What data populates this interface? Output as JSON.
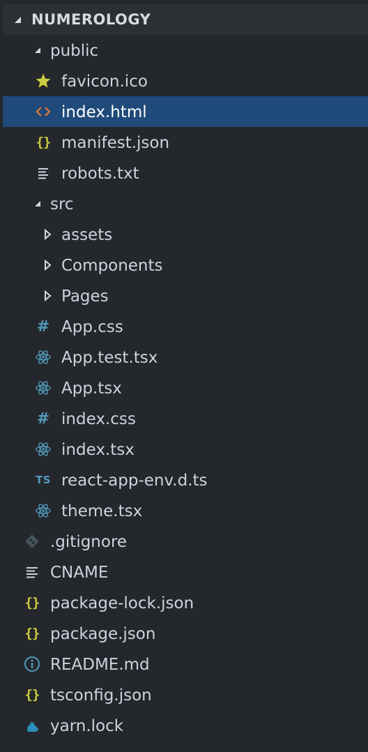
{
  "explorer": {
    "section_title": "NUMEROLOGY"
  },
  "tree": {
    "public": {
      "label": "public",
      "children": {
        "favicon": "favicon.ico",
        "index_html": "index.html",
        "manifest": "manifest.json",
        "robots": "robots.txt"
      }
    },
    "src": {
      "label": "src",
      "children": {
        "assets": "assets",
        "components": "Components",
        "pages": "Pages",
        "app_css": "App.css",
        "app_test": "App.test.tsx",
        "app_tsx": "App.tsx",
        "index_css": "index.css",
        "index_tsx": "index.tsx",
        "react_env": "react-app-env.d.ts",
        "theme": "theme.tsx"
      }
    },
    "root_files": {
      "gitignore": ".gitignore",
      "cname": "CNAME",
      "package_lock": "package-lock.json",
      "package": "package.json",
      "readme": "README.md",
      "tsconfig": "tsconfig.json",
      "yarn_lock": "yarn.lock"
    }
  },
  "icon_badges": {
    "json": "{}",
    "css": "#",
    "ts": "TS"
  },
  "colors": {
    "background": "#24272b",
    "header_background": "#2c2f34",
    "selection": "#1f4a79",
    "json_yellow": "#cbcb41",
    "blue": "#519aba",
    "html_orange": "#e37933",
    "git_gray": "#41535b",
    "yarn_blue": "#2c8ebb"
  }
}
